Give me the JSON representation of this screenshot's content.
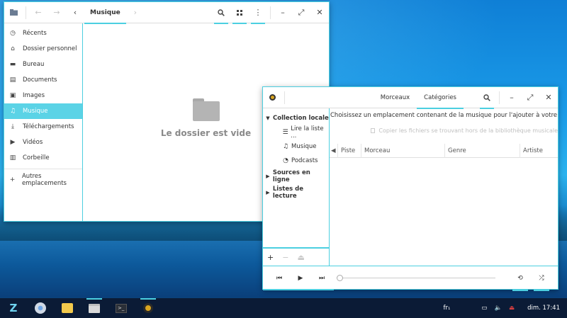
{
  "file_manager": {
    "path_label": "Musique",
    "sidebar": [
      {
        "icon": "clock-icon",
        "glyph": "◷",
        "label": "Récents"
      },
      {
        "icon": "home-icon",
        "glyph": "⌂",
        "label": "Dossier personnel"
      },
      {
        "icon": "desktop-icon",
        "glyph": "▬",
        "label": "Bureau"
      },
      {
        "icon": "document-icon",
        "glyph": "▤",
        "label": "Documents"
      },
      {
        "icon": "image-icon",
        "glyph": "▣",
        "label": "Images"
      },
      {
        "icon": "music-icon",
        "glyph": "♫",
        "label": "Musique",
        "active": true
      },
      {
        "icon": "download-icon",
        "glyph": "⤓",
        "label": "Téléchargements"
      },
      {
        "icon": "video-icon",
        "glyph": "▶",
        "label": "Vidéos"
      },
      {
        "icon": "trash-icon",
        "glyph": "▥",
        "label": "Corbeille"
      },
      {
        "icon": "plus-icon",
        "glyph": "+",
        "label": "Autres emplacements"
      }
    ],
    "empty_message": "Le dossier est vide"
  },
  "music_player": {
    "tabs": [
      {
        "label": "Morceaux",
        "active": false
      },
      {
        "label": "Catégories",
        "active": true
      }
    ],
    "library": {
      "local_collection": "Collection locale",
      "items": [
        {
          "icon": "playlist-icon",
          "glyph": "☰",
          "label": "Lire la liste ..."
        },
        {
          "icon": "music-note-icon",
          "glyph": "♫",
          "label": "Musique"
        },
        {
          "icon": "podcast-icon",
          "glyph": "◔",
          "label": "Podcasts"
        }
      ],
      "online_sources": "Sources en ligne",
      "playlists": "Listes de lecture"
    },
    "info_text": "Choisissez un emplacement contenant de la musique pour l'ajouter à votre biblioth",
    "copy_option": "Copier les fichiers se trouvant hors de la bibliothèque musicale",
    "columns": [
      "Piste",
      "Morceau",
      "Genre",
      "Artiste"
    ]
  },
  "taskbar": {
    "keyboard_layout": "fr₁",
    "clock": "dim. 17:41"
  },
  "colors": {
    "accent": "#4ccfe0",
    "sidebar_active": "#5bd3e6",
    "taskbar": "#0b1b36"
  }
}
